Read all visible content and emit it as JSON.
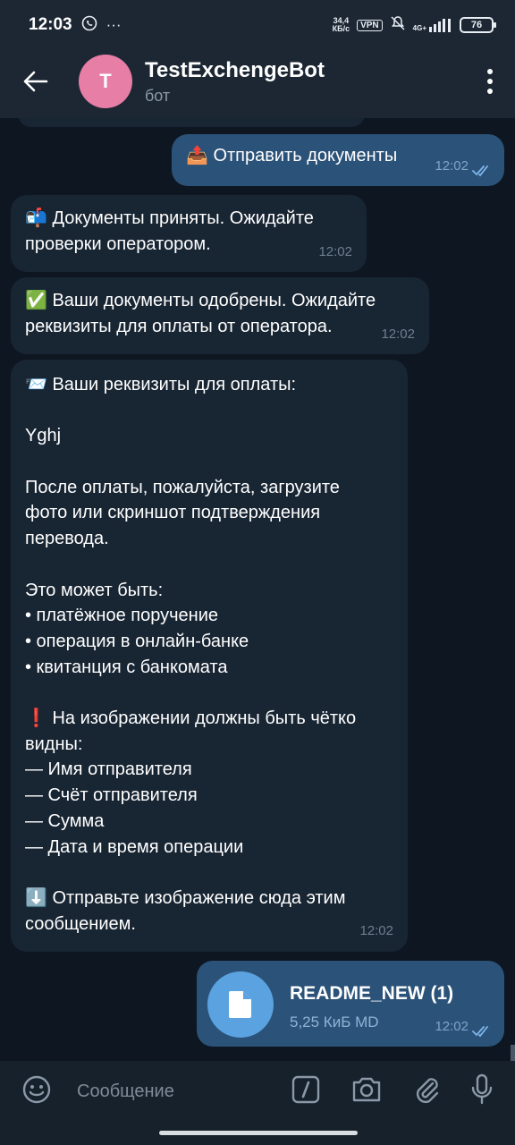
{
  "status_bar": {
    "time": "12:03",
    "speed_value": "34,4",
    "speed_unit": "КБ/с",
    "vpn": "VPN",
    "network": "4G+",
    "battery": "76"
  },
  "header": {
    "avatar_letter": "T",
    "title": "TestExchengeBot",
    "subtitle": "бот"
  },
  "messages": [
    {
      "dir": "out",
      "emoji": "📤",
      "text": "Отправить документы",
      "time": "12:02"
    },
    {
      "dir": "in",
      "emoji": "📬",
      "lines": [
        "Документы приняты. Ожидайте",
        "проверки оператором."
      ],
      "time": "12:02"
    },
    {
      "dir": "in",
      "emoji": "✅",
      "lines": [
        "Ваши документы одобрены. Ожидайте",
        "реквизиты для оплаты от оператора."
      ],
      "time": "12:02"
    },
    {
      "dir": "in",
      "emoji": "📨",
      "time": "12:02",
      "lines": [
        "Ваши реквизиты для оплаты:",
        "",
        "Yghj",
        "",
        "После оплаты, пожалуйста, загрузите",
        "фото или скриншот подтверждения",
        "перевода.",
        "",
        "Это может быть:",
        "• платёжное поручение",
        "• операция в онлайн-банке",
        "• квитанция с банкомата",
        "",
        "❗ На изображении должны быть чётко",
        "видны:",
        "— Имя отправителя",
        "— Счёт отправителя",
        "— Сумма",
        "— Дата и время операции",
        "",
        "⬇️ Отправьте изображение сюда этим",
        "сообщением."
      ]
    },
    {
      "dir": "out",
      "file_name": "README_NEW (1)",
      "file_meta": "5,25 КиБ MD",
      "time": "12:02"
    }
  ],
  "input": {
    "placeholder": "Сообщение"
  },
  "icons": [
    "back-arrow-icon",
    "more-vert-icon",
    "emoji-icon",
    "command-icon",
    "camera-icon",
    "attach-icon",
    "mic-icon",
    "file-icon",
    "double-check-icon"
  ],
  "colors": {
    "background": "#0e1621",
    "incoming": "#182533",
    "outgoing": "#2b5278",
    "accent": "#5aa2e0"
  }
}
